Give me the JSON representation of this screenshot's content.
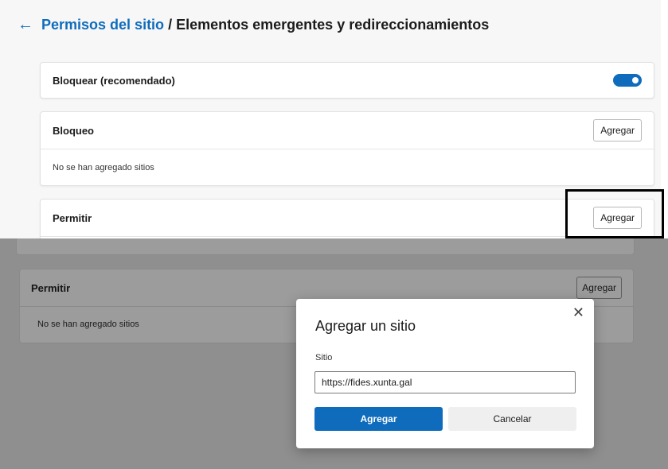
{
  "header": {
    "back_icon": "arrow-left-icon",
    "breadcrumb_link": "Permisos del sitio",
    "separator": "/",
    "current": "Elementos emergentes y redireccionamientos"
  },
  "block_toggle": {
    "label": "Bloquear (recomendado)",
    "enabled": true
  },
  "block_section": {
    "title": "Bloqueo",
    "add_label": "Agregar",
    "empty_text": "No se han agregado sitios"
  },
  "allow_section": {
    "title": "Permitir",
    "add_label": "Agregar"
  },
  "overlay_allow_section": {
    "title": "Permitir",
    "add_label": "Agregar",
    "empty_text": "No se han agregado sitios"
  },
  "dialog": {
    "title": "Agregar un sitio",
    "close_icon": "close-icon",
    "field_label": "Sitio",
    "field_value": "https://fides.xunta.gal",
    "primary_label": "Agregar",
    "secondary_label": "Cancelar"
  },
  "colors": {
    "accent": "#0f6cbd",
    "overlay": "#8f8f8f",
    "highlight_border": "#000000"
  }
}
